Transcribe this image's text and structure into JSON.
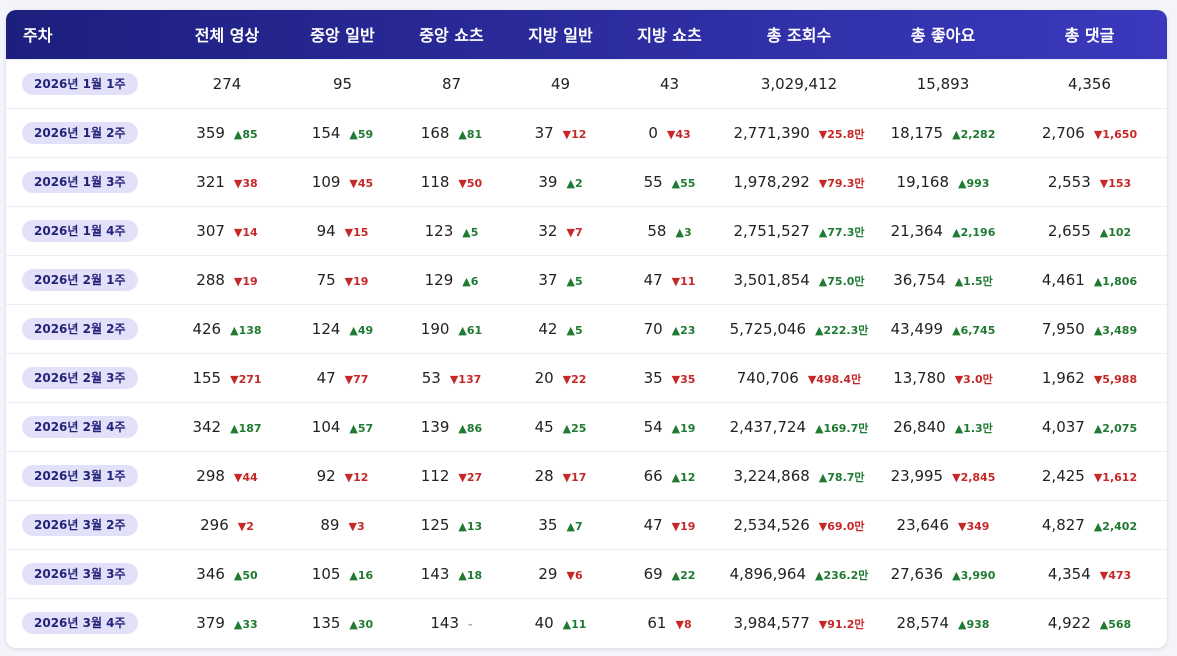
{
  "headers": [
    "주차",
    "전체 영상",
    "중앙 일반",
    "중앙 쇼츠",
    "지방 일반",
    "지방 쇼츠",
    "총 조회수",
    "총 좋아요",
    "총 댓글"
  ],
  "colors": {
    "header_start": "#1d1f7e",
    "header_end": "#3a39bd",
    "up": "#1f7a32",
    "down": "#c62828",
    "pill_bg": "#e2e1f9"
  },
  "rows": [
    {
      "week": "2026년 1월 1주",
      "cells": [
        {
          "v": "274",
          "d": "",
          "t": "none"
        },
        {
          "v": "95",
          "d": "",
          "t": "none"
        },
        {
          "v": "87",
          "d": "",
          "t": "none"
        },
        {
          "v": "49",
          "d": "",
          "t": "none"
        },
        {
          "v": "43",
          "d": "",
          "t": "none"
        },
        {
          "v": "3,029,412",
          "d": "",
          "t": "none"
        },
        {
          "v": "15,893",
          "d": "",
          "t": "none"
        },
        {
          "v": "4,356",
          "d": "",
          "t": "none"
        }
      ]
    },
    {
      "week": "2026년 1월 2주",
      "cells": [
        {
          "v": "359",
          "d": "▲85",
          "t": "up"
        },
        {
          "v": "154",
          "d": "▲59",
          "t": "up"
        },
        {
          "v": "168",
          "d": "▲81",
          "t": "up"
        },
        {
          "v": "37",
          "d": "▼12",
          "t": "down"
        },
        {
          "v": "0",
          "d": "▼43",
          "t": "down"
        },
        {
          "v": "2,771,390",
          "d": "▼25.8만",
          "t": "down"
        },
        {
          "v": "18,175",
          "d": "▲2,282",
          "t": "up"
        },
        {
          "v": "2,706",
          "d": "▼1,650",
          "t": "down"
        }
      ]
    },
    {
      "week": "2026년 1월 3주",
      "cells": [
        {
          "v": "321",
          "d": "▼38",
          "t": "down"
        },
        {
          "v": "109",
          "d": "▼45",
          "t": "down"
        },
        {
          "v": "118",
          "d": "▼50",
          "t": "down"
        },
        {
          "v": "39",
          "d": "▲2",
          "t": "up"
        },
        {
          "v": "55",
          "d": "▲55",
          "t": "up"
        },
        {
          "v": "1,978,292",
          "d": "▼79.3만",
          "t": "down"
        },
        {
          "v": "19,168",
          "d": "▲993",
          "t": "up"
        },
        {
          "v": "2,553",
          "d": "▼153",
          "t": "down"
        }
      ]
    },
    {
      "week": "2026년 1월 4주",
      "cells": [
        {
          "v": "307",
          "d": "▼14",
          "t": "down"
        },
        {
          "v": "94",
          "d": "▼15",
          "t": "down"
        },
        {
          "v": "123",
          "d": "▲5",
          "t": "up"
        },
        {
          "v": "32",
          "d": "▼7",
          "t": "down"
        },
        {
          "v": "58",
          "d": "▲3",
          "t": "up"
        },
        {
          "v": "2,751,527",
          "d": "▲77.3만",
          "t": "up"
        },
        {
          "v": "21,364",
          "d": "▲2,196",
          "t": "up"
        },
        {
          "v": "2,655",
          "d": "▲102",
          "t": "up"
        }
      ]
    },
    {
      "week": "2026년 2월 1주",
      "cells": [
        {
          "v": "288",
          "d": "▼19",
          "t": "down"
        },
        {
          "v": "75",
          "d": "▼19",
          "t": "down"
        },
        {
          "v": "129",
          "d": "▲6",
          "t": "up"
        },
        {
          "v": "37",
          "d": "▲5",
          "t": "up"
        },
        {
          "v": "47",
          "d": "▼11",
          "t": "down"
        },
        {
          "v": "3,501,854",
          "d": "▲75.0만",
          "t": "up"
        },
        {
          "v": "36,754",
          "d": "▲1.5만",
          "t": "up"
        },
        {
          "v": "4,461",
          "d": "▲1,806",
          "t": "up"
        }
      ]
    },
    {
      "week": "2026년 2월 2주",
      "cells": [
        {
          "v": "426",
          "d": "▲138",
          "t": "up"
        },
        {
          "v": "124",
          "d": "▲49",
          "t": "up"
        },
        {
          "v": "190",
          "d": "▲61",
          "t": "up"
        },
        {
          "v": "42",
          "d": "▲5",
          "t": "up"
        },
        {
          "v": "70",
          "d": "▲23",
          "t": "up"
        },
        {
          "v": "5,725,046",
          "d": "▲222.3만",
          "t": "up"
        },
        {
          "v": "43,499",
          "d": "▲6,745",
          "t": "up"
        },
        {
          "v": "7,950",
          "d": "▲3,489",
          "t": "up"
        }
      ]
    },
    {
      "week": "2026년 2월 3주",
      "cells": [
        {
          "v": "155",
          "d": "▼271",
          "t": "down"
        },
        {
          "v": "47",
          "d": "▼77",
          "t": "down"
        },
        {
          "v": "53",
          "d": "▼137",
          "t": "down"
        },
        {
          "v": "20",
          "d": "▼22",
          "t": "down"
        },
        {
          "v": "35",
          "d": "▼35",
          "t": "down"
        },
        {
          "v": "740,706",
          "d": "▼498.4만",
          "t": "down"
        },
        {
          "v": "13,780",
          "d": "▼3.0만",
          "t": "down"
        },
        {
          "v": "1,962",
          "d": "▼5,988",
          "t": "down"
        }
      ]
    },
    {
      "week": "2026년 2월 4주",
      "cells": [
        {
          "v": "342",
          "d": "▲187",
          "t": "up"
        },
        {
          "v": "104",
          "d": "▲57",
          "t": "up"
        },
        {
          "v": "139",
          "d": "▲86",
          "t": "up"
        },
        {
          "v": "45",
          "d": "▲25",
          "t": "up"
        },
        {
          "v": "54",
          "d": "▲19",
          "t": "up"
        },
        {
          "v": "2,437,724",
          "d": "▲169.7만",
          "t": "up"
        },
        {
          "v": "26,840",
          "d": "▲1.3만",
          "t": "up"
        },
        {
          "v": "4,037",
          "d": "▲2,075",
          "t": "up"
        }
      ]
    },
    {
      "week": "2026년 3월 1주",
      "cells": [
        {
          "v": "298",
          "d": "▼44",
          "t": "down"
        },
        {
          "v": "92",
          "d": "▼12",
          "t": "down"
        },
        {
          "v": "112",
          "d": "▼27",
          "t": "down"
        },
        {
          "v": "28",
          "d": "▼17",
          "t": "down"
        },
        {
          "v": "66",
          "d": "▲12",
          "t": "up"
        },
        {
          "v": "3,224,868",
          "d": "▲78.7만",
          "t": "up"
        },
        {
          "v": "23,995",
          "d": "▼2,845",
          "t": "down"
        },
        {
          "v": "2,425",
          "d": "▼1,612",
          "t": "down"
        }
      ]
    },
    {
      "week": "2026년 3월 2주",
      "cells": [
        {
          "v": "296",
          "d": "▼2",
          "t": "down"
        },
        {
          "v": "89",
          "d": "▼3",
          "t": "down"
        },
        {
          "v": "125",
          "d": "▲13",
          "t": "up"
        },
        {
          "v": "35",
          "d": "▲7",
          "t": "up"
        },
        {
          "v": "47",
          "d": "▼19",
          "t": "down"
        },
        {
          "v": "2,534,526",
          "d": "▼69.0만",
          "t": "down"
        },
        {
          "v": "23,646",
          "d": "▼349",
          "t": "down"
        },
        {
          "v": "4,827",
          "d": "▲2,402",
          "t": "up"
        }
      ]
    },
    {
      "week": "2026년 3월 3주",
      "cells": [
        {
          "v": "346",
          "d": "▲50",
          "t": "up"
        },
        {
          "v": "105",
          "d": "▲16",
          "t": "up"
        },
        {
          "v": "143",
          "d": "▲18",
          "t": "up"
        },
        {
          "v": "29",
          "d": "▼6",
          "t": "down"
        },
        {
          "v": "69",
          "d": "▲22",
          "t": "up"
        },
        {
          "v": "4,896,964",
          "d": "▲236.2만",
          "t": "up"
        },
        {
          "v": "27,636",
          "d": "▲3,990",
          "t": "up"
        },
        {
          "v": "4,354",
          "d": "▼473",
          "t": "down"
        }
      ]
    },
    {
      "week": "2026년 3월 4주",
      "cells": [
        {
          "v": "379",
          "d": "▲33",
          "t": "up"
        },
        {
          "v": "135",
          "d": "▲30",
          "t": "up"
        },
        {
          "v": "143",
          "d": "-",
          "t": "flat"
        },
        {
          "v": "40",
          "d": "▲11",
          "t": "up"
        },
        {
          "v": "61",
          "d": "▼8",
          "t": "down"
        },
        {
          "v": "3,984,577",
          "d": "▼91.2만",
          "t": "down"
        },
        {
          "v": "28,574",
          "d": "▲938",
          "t": "up"
        },
        {
          "v": "4,922",
          "d": "▲568",
          "t": "up"
        }
      ]
    }
  ]
}
